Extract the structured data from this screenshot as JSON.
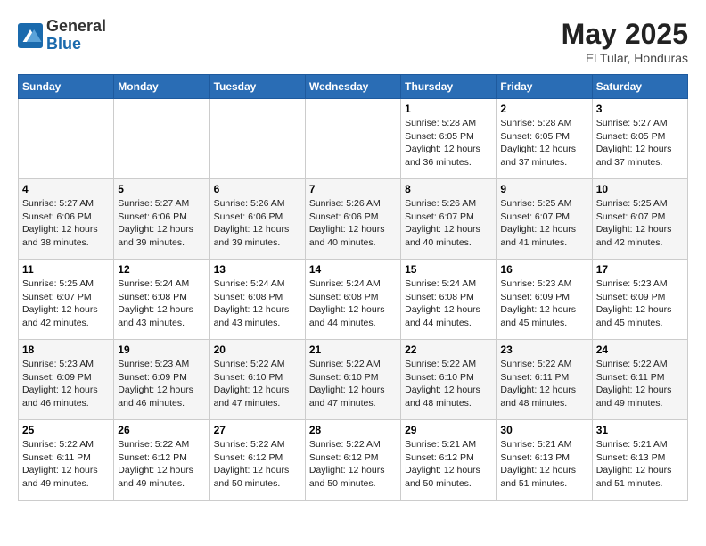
{
  "header": {
    "logo_general": "General",
    "logo_blue": "Blue",
    "month_year": "May 2025",
    "location": "El Tular, Honduras"
  },
  "days_of_week": [
    "Sunday",
    "Monday",
    "Tuesday",
    "Wednesday",
    "Thursday",
    "Friday",
    "Saturday"
  ],
  "weeks": [
    [
      {
        "day": "",
        "info": ""
      },
      {
        "day": "",
        "info": ""
      },
      {
        "day": "",
        "info": ""
      },
      {
        "day": "",
        "info": ""
      },
      {
        "day": "1",
        "info": "Sunrise: 5:28 AM\nSunset: 6:05 PM\nDaylight: 12 hours\nand 36 minutes."
      },
      {
        "day": "2",
        "info": "Sunrise: 5:28 AM\nSunset: 6:05 PM\nDaylight: 12 hours\nand 37 minutes."
      },
      {
        "day": "3",
        "info": "Sunrise: 5:27 AM\nSunset: 6:05 PM\nDaylight: 12 hours\nand 37 minutes."
      }
    ],
    [
      {
        "day": "4",
        "info": "Sunrise: 5:27 AM\nSunset: 6:06 PM\nDaylight: 12 hours\nand 38 minutes."
      },
      {
        "day": "5",
        "info": "Sunrise: 5:27 AM\nSunset: 6:06 PM\nDaylight: 12 hours\nand 39 minutes."
      },
      {
        "day": "6",
        "info": "Sunrise: 5:26 AM\nSunset: 6:06 PM\nDaylight: 12 hours\nand 39 minutes."
      },
      {
        "day": "7",
        "info": "Sunrise: 5:26 AM\nSunset: 6:06 PM\nDaylight: 12 hours\nand 40 minutes."
      },
      {
        "day": "8",
        "info": "Sunrise: 5:26 AM\nSunset: 6:07 PM\nDaylight: 12 hours\nand 40 minutes."
      },
      {
        "day": "9",
        "info": "Sunrise: 5:25 AM\nSunset: 6:07 PM\nDaylight: 12 hours\nand 41 minutes."
      },
      {
        "day": "10",
        "info": "Sunrise: 5:25 AM\nSunset: 6:07 PM\nDaylight: 12 hours\nand 42 minutes."
      }
    ],
    [
      {
        "day": "11",
        "info": "Sunrise: 5:25 AM\nSunset: 6:07 PM\nDaylight: 12 hours\nand 42 minutes."
      },
      {
        "day": "12",
        "info": "Sunrise: 5:24 AM\nSunset: 6:08 PM\nDaylight: 12 hours\nand 43 minutes."
      },
      {
        "day": "13",
        "info": "Sunrise: 5:24 AM\nSunset: 6:08 PM\nDaylight: 12 hours\nand 43 minutes."
      },
      {
        "day": "14",
        "info": "Sunrise: 5:24 AM\nSunset: 6:08 PM\nDaylight: 12 hours\nand 44 minutes."
      },
      {
        "day": "15",
        "info": "Sunrise: 5:24 AM\nSunset: 6:08 PM\nDaylight: 12 hours\nand 44 minutes."
      },
      {
        "day": "16",
        "info": "Sunrise: 5:23 AM\nSunset: 6:09 PM\nDaylight: 12 hours\nand 45 minutes."
      },
      {
        "day": "17",
        "info": "Sunrise: 5:23 AM\nSunset: 6:09 PM\nDaylight: 12 hours\nand 45 minutes."
      }
    ],
    [
      {
        "day": "18",
        "info": "Sunrise: 5:23 AM\nSunset: 6:09 PM\nDaylight: 12 hours\nand 46 minutes."
      },
      {
        "day": "19",
        "info": "Sunrise: 5:23 AM\nSunset: 6:09 PM\nDaylight: 12 hours\nand 46 minutes."
      },
      {
        "day": "20",
        "info": "Sunrise: 5:22 AM\nSunset: 6:10 PM\nDaylight: 12 hours\nand 47 minutes."
      },
      {
        "day": "21",
        "info": "Sunrise: 5:22 AM\nSunset: 6:10 PM\nDaylight: 12 hours\nand 47 minutes."
      },
      {
        "day": "22",
        "info": "Sunrise: 5:22 AM\nSunset: 6:10 PM\nDaylight: 12 hours\nand 48 minutes."
      },
      {
        "day": "23",
        "info": "Sunrise: 5:22 AM\nSunset: 6:11 PM\nDaylight: 12 hours\nand 48 minutes."
      },
      {
        "day": "24",
        "info": "Sunrise: 5:22 AM\nSunset: 6:11 PM\nDaylight: 12 hours\nand 49 minutes."
      }
    ],
    [
      {
        "day": "25",
        "info": "Sunrise: 5:22 AM\nSunset: 6:11 PM\nDaylight: 12 hours\nand 49 minutes."
      },
      {
        "day": "26",
        "info": "Sunrise: 5:22 AM\nSunset: 6:12 PM\nDaylight: 12 hours\nand 49 minutes."
      },
      {
        "day": "27",
        "info": "Sunrise: 5:22 AM\nSunset: 6:12 PM\nDaylight: 12 hours\nand 50 minutes."
      },
      {
        "day": "28",
        "info": "Sunrise: 5:22 AM\nSunset: 6:12 PM\nDaylight: 12 hours\nand 50 minutes."
      },
      {
        "day": "29",
        "info": "Sunrise: 5:21 AM\nSunset: 6:12 PM\nDaylight: 12 hours\nand 50 minutes."
      },
      {
        "day": "30",
        "info": "Sunrise: 5:21 AM\nSunset: 6:13 PM\nDaylight: 12 hours\nand 51 minutes."
      },
      {
        "day": "31",
        "info": "Sunrise: 5:21 AM\nSunset: 6:13 PM\nDaylight: 12 hours\nand 51 minutes."
      }
    ]
  ]
}
